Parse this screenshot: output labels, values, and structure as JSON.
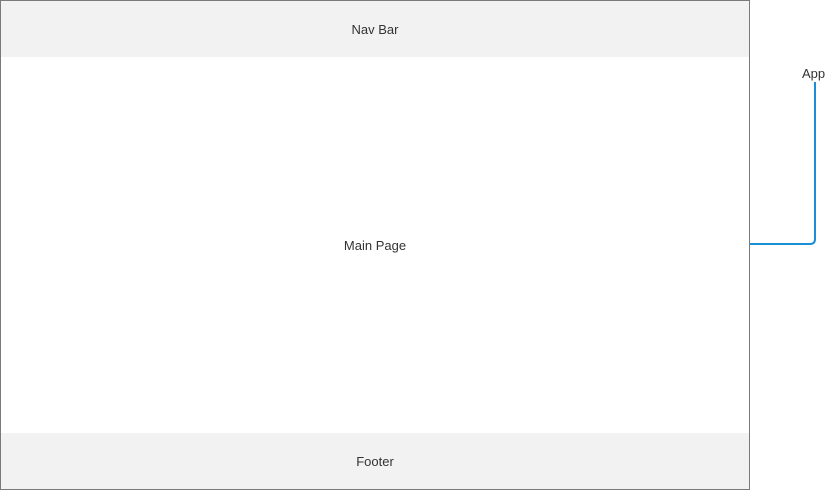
{
  "diagram": {
    "nav_label": "Nav Bar",
    "main_label": "Main Page",
    "footer_label": "Footer",
    "callout_label": "App",
    "connector_color": "#1a8fd6"
  }
}
